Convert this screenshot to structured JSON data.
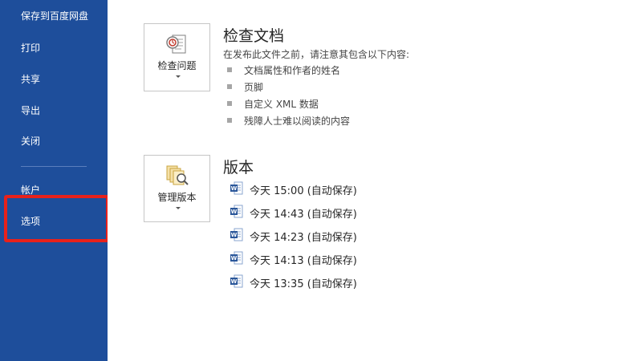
{
  "sidebar": {
    "items": [
      {
        "label": "保存到百度网盘"
      },
      {
        "label": "打印"
      },
      {
        "label": "共享"
      },
      {
        "label": "导出"
      },
      {
        "label": "关闭"
      },
      {
        "label": "帐户"
      },
      {
        "label": "选项"
      }
    ]
  },
  "inspect": {
    "button_label": "检查问题",
    "title": "检查文档",
    "description": "在发布此文件之前，请注意其包含以下内容:",
    "items": [
      {
        "text": "文档属性和作者的姓名"
      },
      {
        "text": "页脚"
      },
      {
        "text": "自定义 XML 数据"
      },
      {
        "text": "残障人士难以阅读的内容"
      }
    ]
  },
  "versions": {
    "button_label": "管理版本",
    "title": "版本",
    "items": [
      {
        "label": "今天 15:00 (自动保存)"
      },
      {
        "label": "今天 14:43 (自动保存)"
      },
      {
        "label": "今天 14:23 (自动保存)"
      },
      {
        "label": "今天 14:13 (自动保存)"
      },
      {
        "label": "今天 13:35 (自动保存)"
      }
    ]
  },
  "colors": {
    "sidebar_bg": "#1e4e9b",
    "highlight": "#e8211b",
    "word_icon": "#2b579a"
  },
  "icons": {
    "inspect": "inspect-document-icon",
    "versions": "manage-versions-icon",
    "version_file": "word-document-icon"
  }
}
